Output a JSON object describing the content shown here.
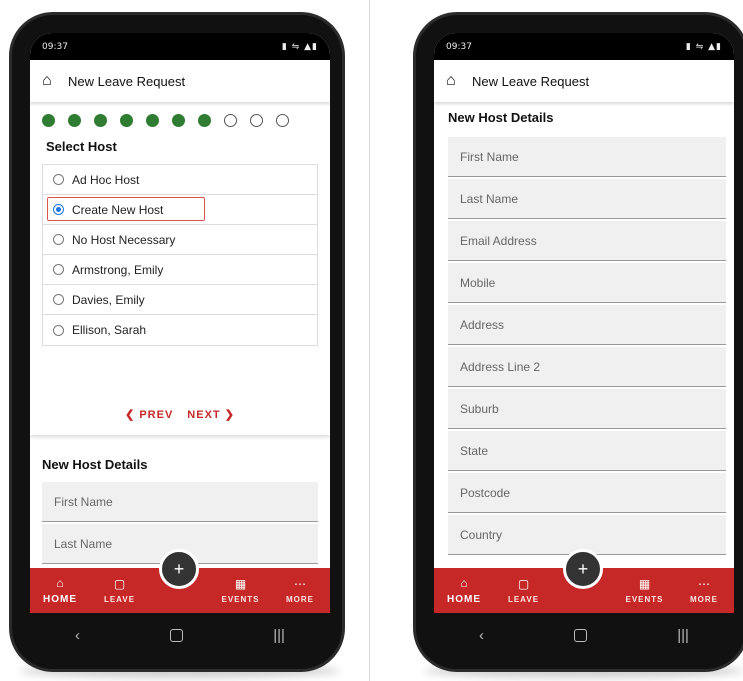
{
  "left": {
    "status": {
      "time": "09:37",
      "icons": "▮ ⇋ ▲▮"
    },
    "appbar": {
      "title": "New Leave Request"
    },
    "steps": {
      "done": 7,
      "total": 10
    },
    "section_title": "Select Host",
    "hosts": [
      {
        "label": "Ad Hoc Host",
        "selected": false
      },
      {
        "label": "Create New Host",
        "selected": true
      },
      {
        "label": "No Host Necessary",
        "selected": false
      },
      {
        "label": "Armstrong, Emily",
        "selected": false
      },
      {
        "label": "Davies, Emily",
        "selected": false
      },
      {
        "label": "Ellison, Sarah",
        "selected": false
      }
    ],
    "nav": {
      "prev": "❮ PREV",
      "next": "NEXT ❯"
    },
    "lower_title": "New Host Details",
    "fields": [
      "First Name",
      "Last Name"
    ]
  },
  "right": {
    "status": {
      "time": "09:37",
      "icons": "▮ ⇋ ▲▮"
    },
    "appbar": {
      "title": "New Leave Request"
    },
    "section_title": "New Host Details",
    "fields": [
      "First Name",
      "Last Name",
      "Email Address",
      "Mobile",
      "Address",
      "Address Line 2",
      "Suburb",
      "State",
      "Postcode",
      "Country"
    ]
  },
  "bottom_nav": {
    "home": "HOME",
    "leave": "LEAVE",
    "events": "EVENTS",
    "more": "MORE",
    "fab": "+"
  },
  "colors": {
    "accent": "#c62828",
    "step_done": "#2e7d32",
    "radio": "#1a73e8"
  }
}
